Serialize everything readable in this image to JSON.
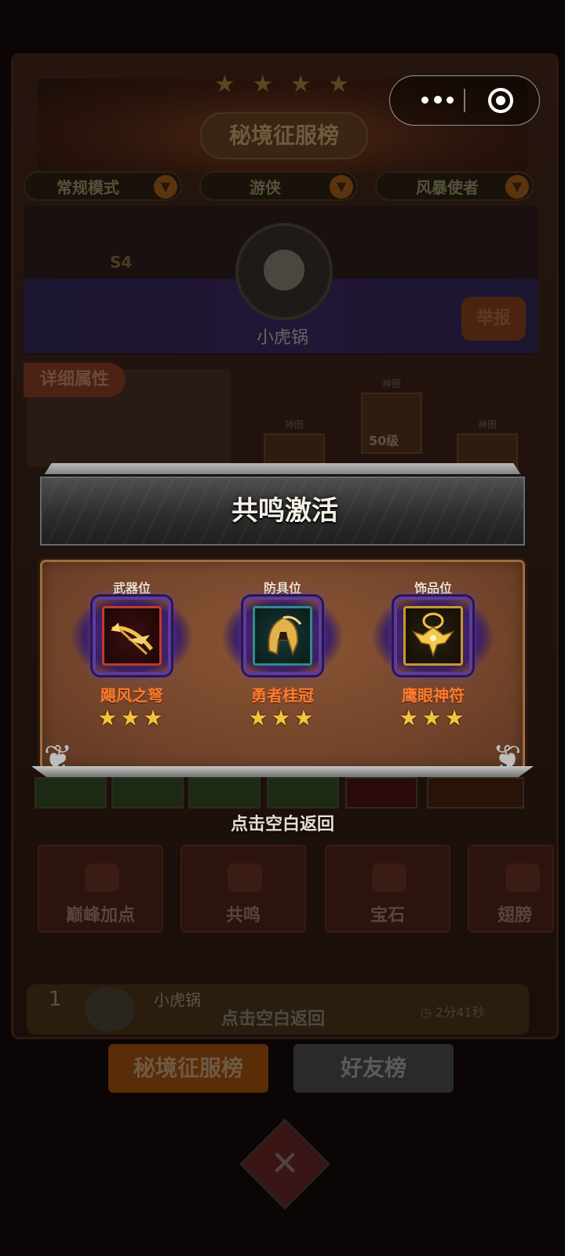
{
  "background": {
    "leaderboard_title": "秘境征服榜",
    "filters": [
      "常规模式",
      "游侠",
      "风暴使者"
    ],
    "season": "S4",
    "player_name": "小虎锅",
    "report_button": "举报",
    "detail_tab": "详细属性",
    "slot_tag": "神圈",
    "slot_level": "50级",
    "function_buttons": [
      "巅峰加点",
      "共鸣",
      "宝石",
      "翅膀"
    ],
    "rank_row": {
      "rank": "1",
      "name": "小虎锅",
      "time": "2分41秒",
      "hint": "点击空白返回"
    },
    "bottom_tabs": [
      "秘境征服榜",
      "好友榜"
    ]
  },
  "capsule": {
    "more_icon": "more-dots-icon",
    "close_icon": "target-circle-icon"
  },
  "popup": {
    "title": "共鸣激活",
    "items": [
      {
        "slot": "武器位",
        "name": "飓风之弩",
        "stars": "★★★",
        "icon": "crossbow-icon",
        "frame_color": "#c0392b"
      },
      {
        "slot": "防具位",
        "name": "勇者桂冠",
        "stars": "★★★",
        "icon": "golden-helmet-icon",
        "frame_color": "#2e8c86"
      },
      {
        "slot": "饰品位",
        "name": "鹰眼神符",
        "stars": "★★★",
        "icon": "eagle-amulet-icon",
        "frame_color": "#c69a2a"
      }
    ]
  },
  "footer_hint": "点击空白返回",
  "colors": {
    "item_name": "#ff7b2e",
    "star": "#f5c33b",
    "popup_body": "#7a4a2e"
  }
}
